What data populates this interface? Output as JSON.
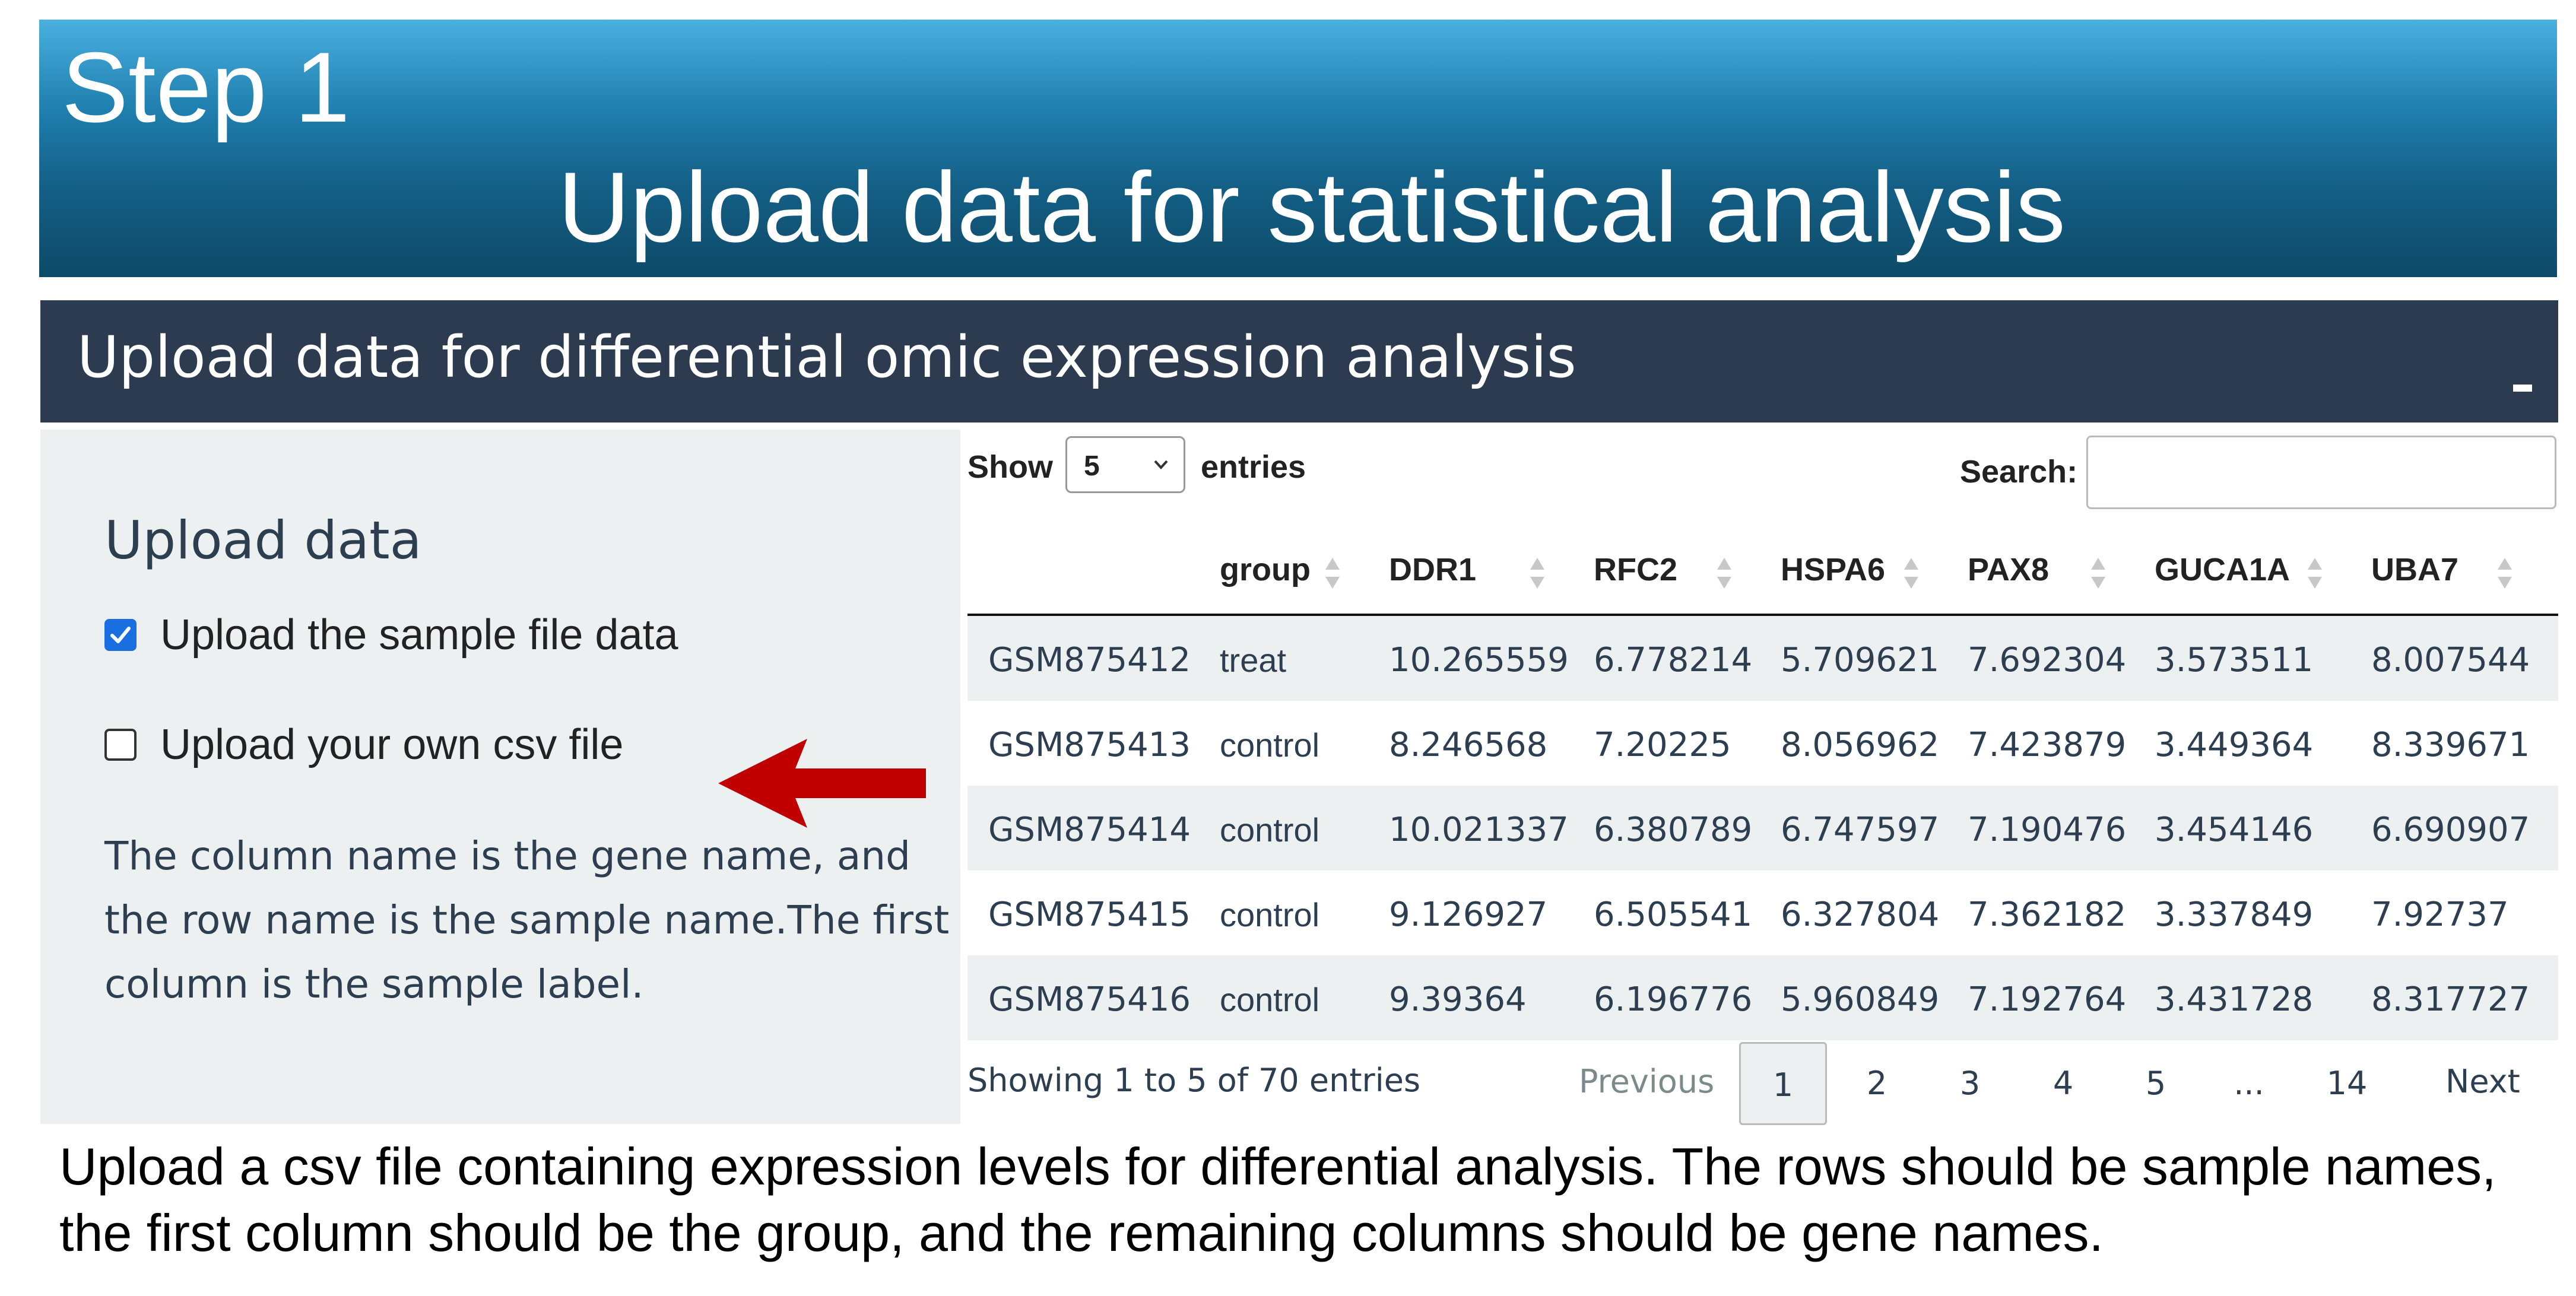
{
  "banner": {
    "step": "Step 1",
    "title": "Upload data for statistical analysis"
  },
  "box": {
    "title": "Upload data for differential omic expression analysis",
    "collapse_label": "-"
  },
  "sidebar": {
    "title": "Upload data",
    "option_sample": {
      "label": "Upload the sample file data",
      "checked": true
    },
    "option_own": {
      "label": "Upload your own csv file",
      "checked": false
    },
    "help_text": "The column name is the gene name, and the row name is the sample name.The first column is the sample label."
  },
  "table": {
    "length_label_show": "Show",
    "length_value": "5",
    "length_label_entries": "entries",
    "search_label": "Search:",
    "search_value": "",
    "columns": [
      "",
      "group",
      "DDR1",
      "RFC2",
      "HSPA6",
      "PAX8",
      "GUCA1A",
      "UBA7"
    ],
    "rows": [
      [
        "GSM875412",
        "treat",
        "10.265559",
        "6.778214",
        "5.709621",
        "7.692304",
        "3.573511",
        "8.007544"
      ],
      [
        "GSM875413",
        "control",
        "8.246568",
        "7.20225",
        "8.056962",
        "7.423879",
        "3.449364",
        "8.339671"
      ],
      [
        "GSM875414",
        "control",
        "10.021337",
        "6.380789",
        "6.747597",
        "7.190476",
        "3.454146",
        "6.690907"
      ],
      [
        "GSM875415",
        "control",
        "9.126927",
        "6.505541",
        "6.327804",
        "7.362182",
        "3.337849",
        "7.92737"
      ],
      [
        "GSM875416",
        "control",
        "9.39364",
        "6.196776",
        "5.960849",
        "7.192764",
        "3.431728",
        "8.317727"
      ]
    ],
    "info": "Showing 1 to 5 of 70 entries",
    "pagination": {
      "previous": "Previous",
      "pages": [
        "1",
        "2",
        "3",
        "4",
        "5",
        "...",
        "14"
      ],
      "current": "1",
      "next": "Next"
    }
  },
  "caption": "Upload a csv file containing expression levels for differential analysis. The rows should be sample names, the first column should be the group, and the remaining columns should be gene names.",
  "colors": {
    "header_bg": "#2c3b4f",
    "sidebar_bg": "#ecf0f1",
    "checkbox_accent": "#1a6fe0",
    "arrow": "#c00000",
    "banner_top": "#4ab0e0",
    "banner_bottom": "#0e4a68"
  }
}
